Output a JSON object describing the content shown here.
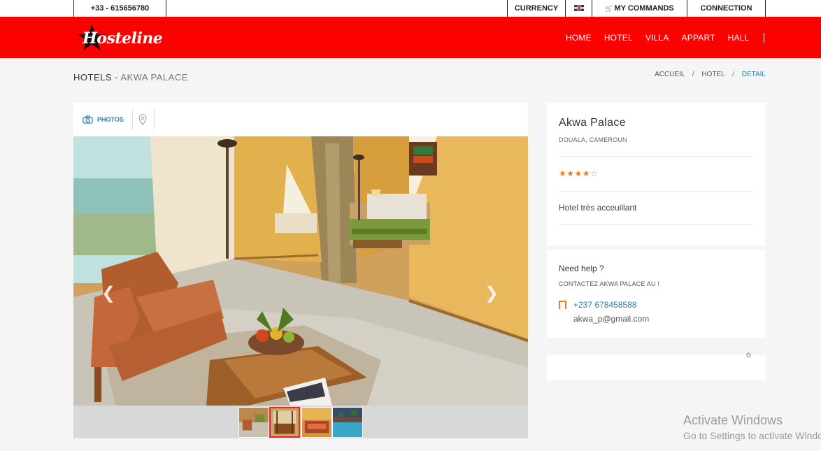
{
  "topbar": {
    "phone": "+33 - 615656780",
    "currency": "CURRENCY",
    "commands": "MY COMMANDS",
    "connection": "CONNECTION",
    "language_icon": "uk-flag-icon",
    "cart_icon": "cart-icon"
  },
  "header": {
    "logo_text": "Hosteline",
    "nav": [
      "HOME",
      "HOTEL",
      "VILLA",
      "APPART",
      "HALL"
    ]
  },
  "page": {
    "title": "HOTELS",
    "title_sep": " - ",
    "subtitle": "AKWA PALACE"
  },
  "breadcrumb": {
    "items": [
      "ACCUEIL",
      "HOTEL",
      "DETAIL"
    ],
    "separator": "/"
  },
  "tabs": {
    "photos": "PHOTOS",
    "photos_icon": "camera-icon",
    "map_icon": "map-pin-icon"
  },
  "gallery": {
    "prev_glyph": "❮",
    "next_glyph": "❯",
    "thumbnails": 4,
    "active_thumbnail": 2
  },
  "hotel": {
    "name": "Akwa Palace",
    "location": "DOUALA, CAMEROUN",
    "rating": 4,
    "rating_max": 5,
    "description": "Hotel très acceuillant"
  },
  "help": {
    "title": "Need help ?",
    "subtitle": "CONTACTEZ AKWA PALACE AU !",
    "phone": "+237 678458588",
    "email": "akwa_p@gmail.com"
  },
  "extra": {
    "glyph": "o"
  },
  "watermark": {
    "title": "Activate Windows",
    "subtitle": "Go to Settings to activate Windows."
  },
  "colors": {
    "brand_red": "#fd0000",
    "link_blue": "#2a7fae",
    "star_orange": "#f27a16"
  }
}
